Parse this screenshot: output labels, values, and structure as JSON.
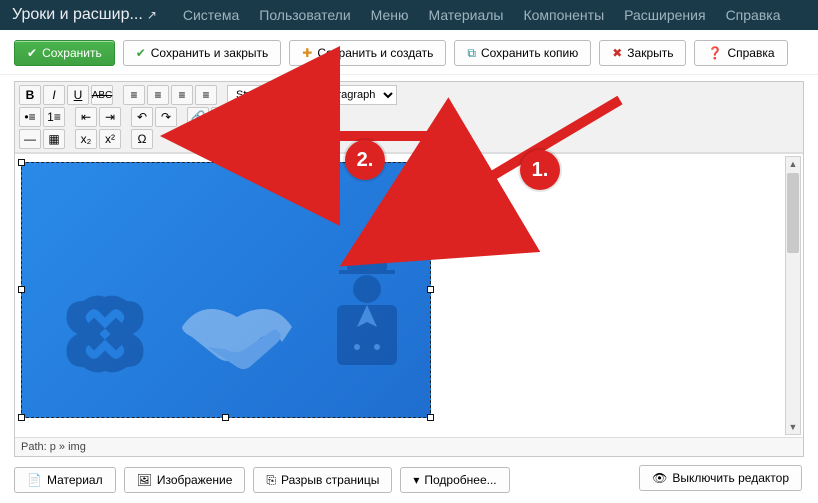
{
  "topnav": {
    "title": "Уроки и расшир...",
    "items": [
      "Система",
      "Пользователи",
      "Меню",
      "Материалы",
      "Компоненты",
      "Расширения",
      "Справка"
    ]
  },
  "toolbar": {
    "save": "Сохранить",
    "save_close": "Сохранить и закрыть",
    "save_new": "Сохранить и создать",
    "save_copy": "Сохранить копию",
    "close": "Закрыть",
    "help": "Справка"
  },
  "editor": {
    "styles_label": "Styles",
    "paragraph_label": "Paragraph",
    "path_label": "Path: p » img"
  },
  "bottom": {
    "material": "Материал",
    "image": "Изображение",
    "pagebreak": "Разрыв страницы",
    "readmore": "Подробнее..."
  },
  "toggle_editor": "Выключить редактор",
  "annotations": {
    "one": "1.",
    "two": "2."
  }
}
